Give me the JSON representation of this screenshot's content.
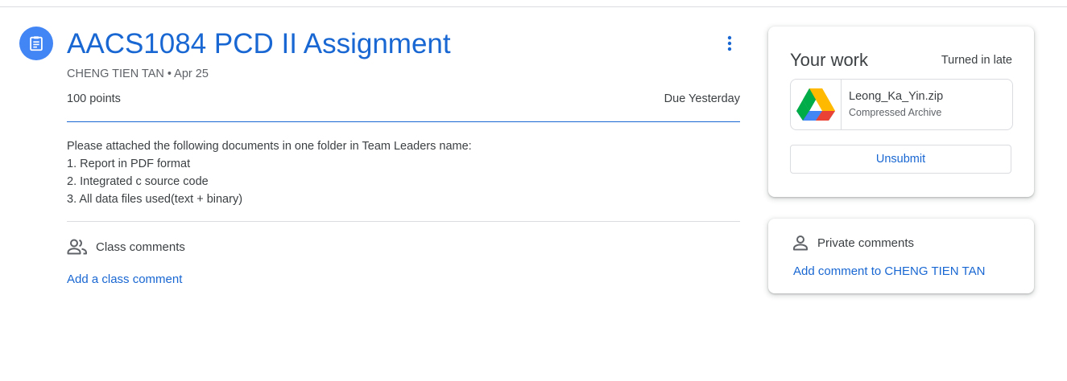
{
  "assignment": {
    "title": "AACS1084 PCD II Assignment",
    "meta": "CHENG TIEN TAN • Apr 25",
    "points": "100 points",
    "due": "Due Yesterday",
    "icon": "assignment-icon",
    "more_icon": "more-vert-icon",
    "description": [
      "Please attached the following documents in one folder in Team Leaders name:",
      "1. Report in PDF format",
      "2. Integrated c source code",
      "3. All data files used(text + binary)"
    ]
  },
  "class_comments": {
    "label": "Class comments",
    "icon": "people-icon",
    "add_label": "Add a class comment"
  },
  "your_work": {
    "title": "Your work",
    "status": "Turned in late",
    "attachment": {
      "name": "Leong_Ka_Yin.zip",
      "type": "Compressed Archive",
      "icon": "google-drive-icon"
    },
    "unsubmit_label": "Unsubmit"
  },
  "private_comments": {
    "label": "Private comments",
    "icon": "person-icon",
    "add_label": "Add comment to CHENG TIEN TAN"
  },
  "colors": {
    "accent": "#1967d2",
    "icon_bg": "#4285f4",
    "text": "#3c4043",
    "secondary_text": "#5f6368",
    "divider": "#dadce0"
  }
}
